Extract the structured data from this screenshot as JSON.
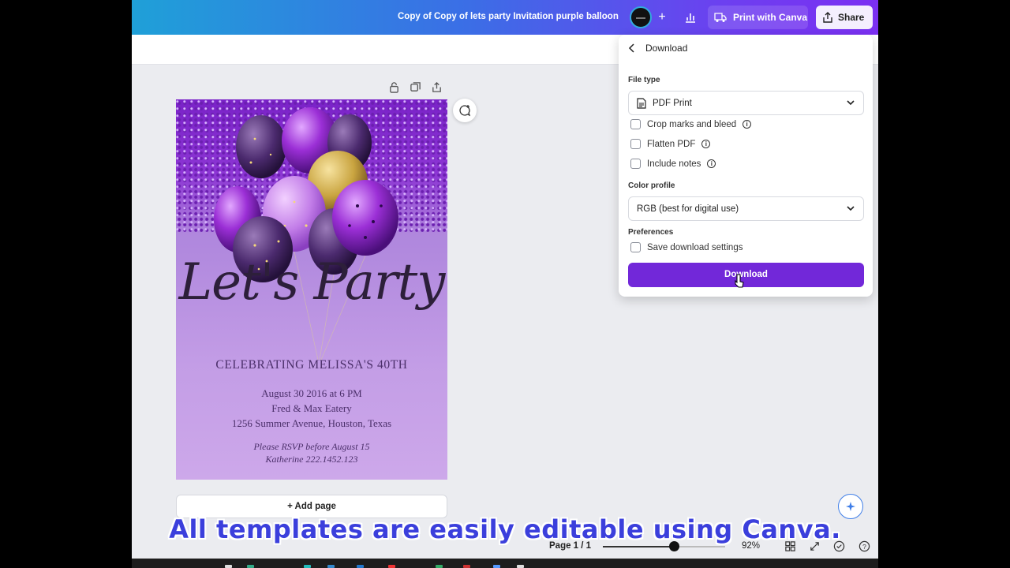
{
  "topbar": {
    "doc_title": "Copy of Copy of lets party Invitation purple balloon",
    "print_label": "Print with Canva",
    "share_label": "Share"
  },
  "design": {
    "headline": "Let's Party",
    "celebrating": "CELEBRATING MELISSA'S 40TH",
    "date": "August 30 2016 at 6 PM",
    "venue": "Fred & Max Eatery",
    "address": "1256 Summer Avenue, Houston, Texas",
    "rsvp": "Please RSVP before August 15",
    "contact": "Katherine 222.1452.123"
  },
  "canvas": {
    "add_page_label": "+ Add page"
  },
  "download_panel": {
    "title": "Download",
    "file_type_label": "File type",
    "file_type_value": "PDF Print",
    "options": [
      {
        "label": "Crop marks and bleed",
        "checked": false
      },
      {
        "label": "Flatten PDF",
        "checked": false
      },
      {
        "label": "Include notes",
        "checked": false
      }
    ],
    "color_profile_label": "Color profile",
    "color_profile_value": "RGB (best for digital use)",
    "preferences_label": "Preferences",
    "save_settings_label": "Save download settings",
    "download_button_label": "Download"
  },
  "bottombar": {
    "page_count": "Page 1 / 1",
    "zoom_level": "92%",
    "zoom_fraction": 0.58
  },
  "caption": "All templates are easily editable using Canva.",
  "colors": {
    "accent_purple": "#7228d9",
    "caption_blue": "#3b3fdc"
  }
}
